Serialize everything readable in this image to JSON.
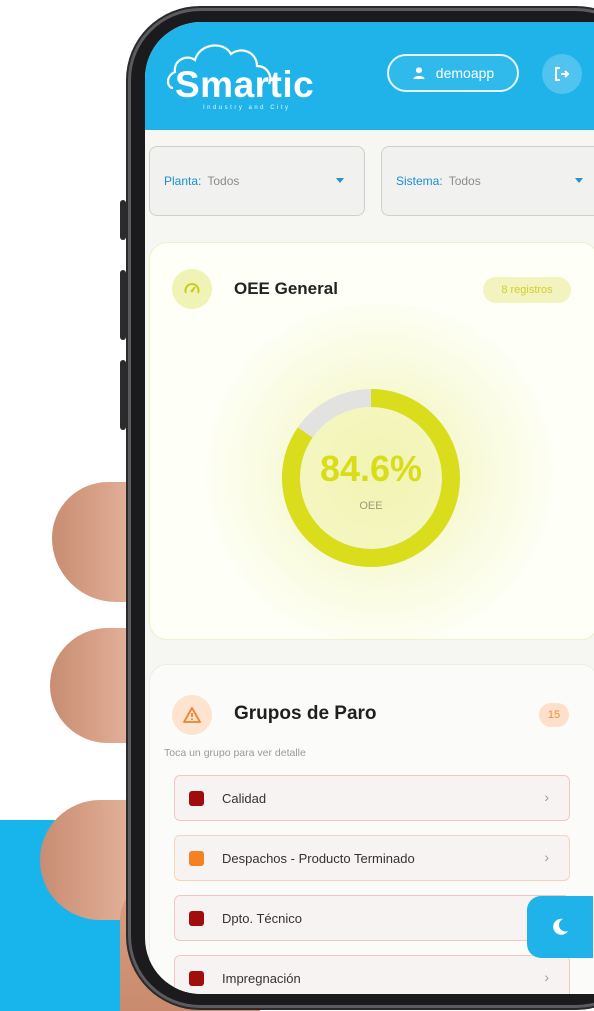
{
  "app": {
    "logo_text": "Smartic",
    "logo_subtitle": "Industry and City",
    "user_label": "demoapp"
  },
  "filters": {
    "planta": {
      "label": "Planta:",
      "value": "Todos"
    },
    "sistema": {
      "label": "Sistema:",
      "value": "Todos"
    }
  },
  "oee": {
    "title": "OEE General",
    "badge": "8 registros",
    "value_text": "84.6%",
    "value": 84.6,
    "label": "OEE",
    "accent_color": "#dadd1b"
  },
  "paro": {
    "title": "Grupos de Paro",
    "count": "15",
    "subtitle": "Toca un grupo para ver detalle",
    "groups": [
      {
        "label": "Calidad",
        "color": "#a10d0d"
      },
      {
        "label": "Despachos - Producto Terminado",
        "color": "#f28224"
      },
      {
        "label": "Dpto. Técnico",
        "color": "#a10d0d"
      },
      {
        "label": "Impregnación",
        "color": "#a10d0d"
      }
    ]
  },
  "icons": {
    "user": "user-icon",
    "logout": "logout-icon",
    "gauge": "speedometer-icon",
    "warning": "warning-icon",
    "moon": "moon-icon",
    "chevron": "chevron-right-icon"
  }
}
